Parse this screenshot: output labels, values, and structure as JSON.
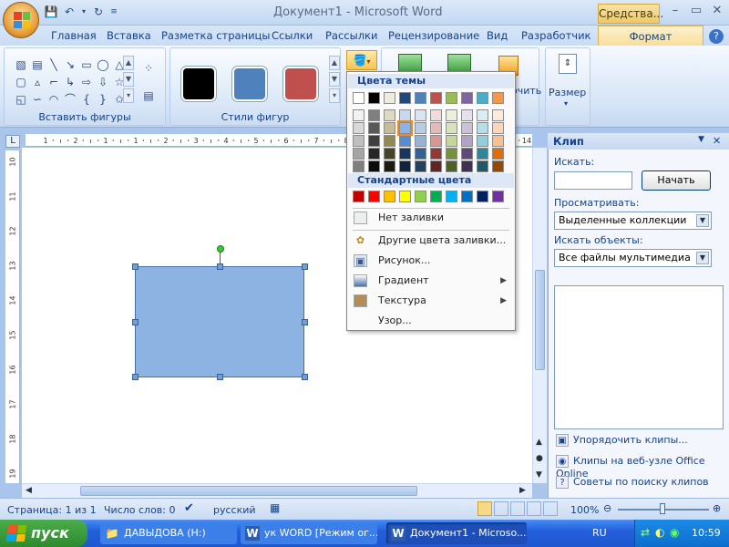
{
  "window": {
    "title": "Документ1 - Microsoft Word",
    "tools_tab": "Средства..."
  },
  "tabs": [
    "Главная",
    "Вставка",
    "Разметка страницы",
    "Ссылки",
    "Рассылки",
    "Рецензирование",
    "Вид",
    "Разработчик"
  ],
  "active_tab": "Формат",
  "ribbon": {
    "insert_shapes_label": "Вставить фигуры",
    "shape_styles_label": "Стили фигур",
    "size_label": "Размер",
    "arrange_fragment": "очить"
  },
  "style_colors": [
    "#000000",
    "#4f81bd",
    "#c0504d"
  ],
  "fill_menu": {
    "theme_header": "Цвета темы",
    "theme_row": [
      "#ffffff",
      "#000000",
      "#eeece1",
      "#1f497d",
      "#4f81bd",
      "#c0504d",
      "#9bbb59",
      "#8064a2",
      "#4bacc6",
      "#f79646"
    ],
    "theme_shades": [
      [
        "#f2f2f2",
        "#7f7f7f",
        "#ddd9c3",
        "#c6d9f0",
        "#dbe5f1",
        "#f2dcdb",
        "#ebf1dd",
        "#e5e0ec",
        "#dbeef3",
        "#fdeada"
      ],
      [
        "#d8d8d8",
        "#595959",
        "#c4bd97",
        "#8db3e2",
        "#b8cce4",
        "#e5b9b7",
        "#d7e3bc",
        "#ccc1d9",
        "#b7dde8",
        "#fbd5b5"
      ],
      [
        "#bfbfbf",
        "#3f3f3f",
        "#938953",
        "#548dd4",
        "#95b3d7",
        "#d99694",
        "#c3d69b",
        "#b2a2c7",
        "#92cddc",
        "#fac08f"
      ],
      [
        "#a5a5a5",
        "#262626",
        "#494429",
        "#17365d",
        "#366092",
        "#953734",
        "#76923c",
        "#5f497a",
        "#31859b",
        "#e36c09"
      ],
      [
        "#7f7f7f",
        "#0c0c0c",
        "#1d1b10",
        "#0f243e",
        "#244061",
        "#632423",
        "#4f6128",
        "#3f3151",
        "#205867",
        "#974806"
      ]
    ],
    "standard_header": "Стандартные цвета",
    "standard_row": [
      "#c00000",
      "#ff0000",
      "#ffc000",
      "#ffff00",
      "#92d050",
      "#00b050",
      "#00b0f0",
      "#0070c0",
      "#002060",
      "#7030a0"
    ],
    "no_fill": "Нет заливки",
    "more_colors": "Другие цвета заливки...",
    "picture": "Рисунок...",
    "gradient": "Градиент",
    "texture": "Текстура",
    "pattern": "Узор..."
  },
  "clip_panel": {
    "title": "Клип",
    "search_label": "Искать:",
    "search_value": "",
    "go_button": "Начать",
    "browse_label": "Просматривать:",
    "browse_value": "Выделенные коллекции",
    "objects_label": "Искать объекты:",
    "objects_value": "Все файлы мультимедиа",
    "link_organize": "Упорядочить клипы...",
    "link_online": "Клипы на веб-узле Office Online",
    "link_tips": "Советы по поиску клипов"
  },
  "ruler_v_numbers": [
    "10",
    "11",
    "12",
    "13",
    "14",
    "15",
    "16",
    "17",
    "18",
    "19"
  ],
  "ruler_h_numbers": [
    "1",
    "2",
    "1",
    "1",
    "2",
    "3",
    "4",
    "5",
    "6",
    "7",
    "8",
    "9",
    "10",
    "11",
    "12",
    "13",
    "14"
  ],
  "status": {
    "page": "Страница: 1 из 1",
    "words": "Число слов: 0",
    "language": "русский",
    "zoom": "100%"
  },
  "taskbar": {
    "start": "пуск",
    "items": [
      "ДАВЫДОВА (H:)",
      "ук WORD [Режим ог...",
      "Документ1 - Microso..."
    ],
    "lang": "RU",
    "clock": "10:59"
  }
}
